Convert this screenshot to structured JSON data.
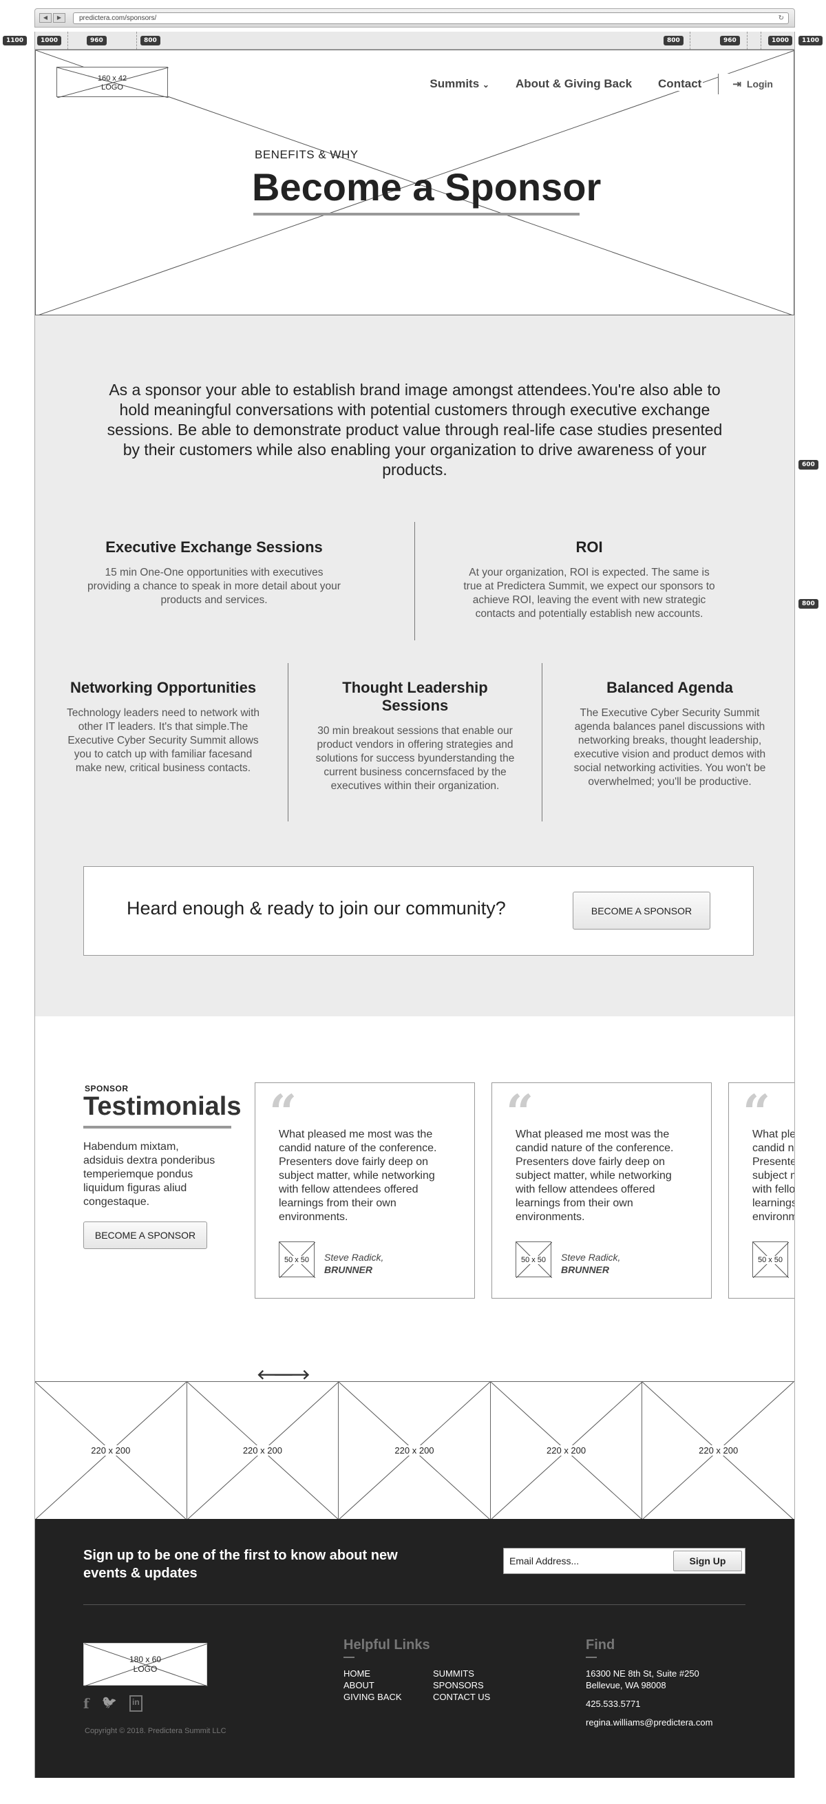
{
  "browser": {
    "url": "predictera.com/sponsors/",
    "back": "◀",
    "forward": "▶",
    "reload": "↻"
  },
  "ruler": {
    "left_tags": [
      "1100",
      "1000",
      "960",
      "800"
    ],
    "right_tags": [
      "800",
      "960",
      "1000",
      "1100"
    ],
    "side_tags": [
      "600",
      "800"
    ]
  },
  "header": {
    "logo": "160 x 42\nLOGO",
    "nav": {
      "summits": "Summits",
      "about": "About & Giving Back",
      "contact": "Contact",
      "login": "Login"
    },
    "eyebrow": "BENEFITS & WHY",
    "title": "Become a Sponsor"
  },
  "benefits": {
    "intro": "As a sponsor your able to establish brand image amongst attendees.You're also able to  hold meaningful conversations with potential customers through executive exchange sessions. Be able to demonstrate product value through real-life case studies presented by their customers while also enabling your organization to drive awareness of your products.",
    "features": [
      {
        "title": "Executive Exchange Sessions",
        "text": "15 min One-One opportunities with executives providing a chance to speak in more detail about your products and services."
      },
      {
        "title": "ROI",
        "text": "At your organization, ROI is expected. The same is true at Predictera Summit, we expect our sponsors to achieve ROI, leaving the event with new strategic contacts and potentially establish new accounts."
      },
      {
        "title": "Networking Opportunities",
        "text": "Technology leaders need to network with other IT leaders. It's that simple.The Executive Cyber Security Summit allows you to catch up with familiar facesand make new, critical business contacts."
      },
      {
        "title": "Thought Leadership Sessions",
        "text": "30 min breakout sessions that enable our product vendors in offering strategies and solutions for success byunderstanding the current business concernsfaced by the executives within their organization."
      },
      {
        "title": "Balanced Agenda",
        "text": "The Executive Cyber Security Summit agenda balances panel discussions with networking breaks, thought leadership, executive vision and product demos with social networking activities. You won't be overwhelmed; you'll be productive."
      }
    ],
    "cta": {
      "text": "Heard enough & ready to join our community?",
      "button": "BECOME A SPONSOR"
    }
  },
  "testimonials": {
    "eyebrow": "SPONSOR",
    "title": "Testimonials",
    "body": "Habendum mixtam, adsiduis dextra ponderibus temperiemque pondus liquidum figuras aliud congestaque.",
    "button": "BECOME A SPONSOR",
    "quote_glyph": "“",
    "cards": [
      {
        "quote": "What pleased me most was the candid nature of the conference. Presenters dove fairly deep on subject matter, while networking with fellow attendees offered learnings from their own environments.",
        "avatar": "50 x 50",
        "name": "Steve Radick,",
        "company": "BRUNNER"
      },
      {
        "quote": "What pleased me most was the candid nature of the conference. Presenters dove fairly deep on subject matter, while networking with fellow attendees offered learnings from their own environments.",
        "avatar": "50 x 50",
        "name": "Steve Radick,",
        "company": "BRUNNER"
      },
      {
        "quote": "What pleased me most was the candid nature of the conference. Presenters dove fairly deep on subject matter, while networking with fellow attendees offered learnings from their own environments.",
        "avatar": "50 x 50",
        "name": "",
        "company": ""
      }
    ],
    "prev": "🡐",
    "next": "🡒"
  },
  "gallery": {
    "tiles": [
      "220 x 200",
      "220 x 200",
      "220 x 200",
      "220 x 200",
      "220 x 200"
    ]
  },
  "footer": {
    "signup_text": "Sign up to be one of the first to know about new events & updates",
    "email_placeholder": "Email Address...",
    "signup_button": "Sign Up",
    "logo": "180 x 60\nLOGO",
    "social": {
      "facebook": "f",
      "twitter": "🐦",
      "linkedin": "in"
    },
    "copyright": "Copyright © 2018. Predictera Summit LLC",
    "helpful_links_title": "Helpful Links",
    "links_col1": [
      "HOME",
      "ABOUT",
      "GIVING BACK"
    ],
    "links_col2": [
      "SUMMITS",
      "SPONSORS",
      "CONTACT US"
    ],
    "find_title": "Find",
    "address1": "16300 NE 8th St, Suite #250",
    "address2": "Bellevue, WA 98008",
    "phone": "425.533.5771",
    "email": "regina.williams@predictera.com"
  },
  "colors": {
    "footer_bg": "#222222",
    "section_gray": "#ececec",
    "accent_bar": "#999999"
  }
}
